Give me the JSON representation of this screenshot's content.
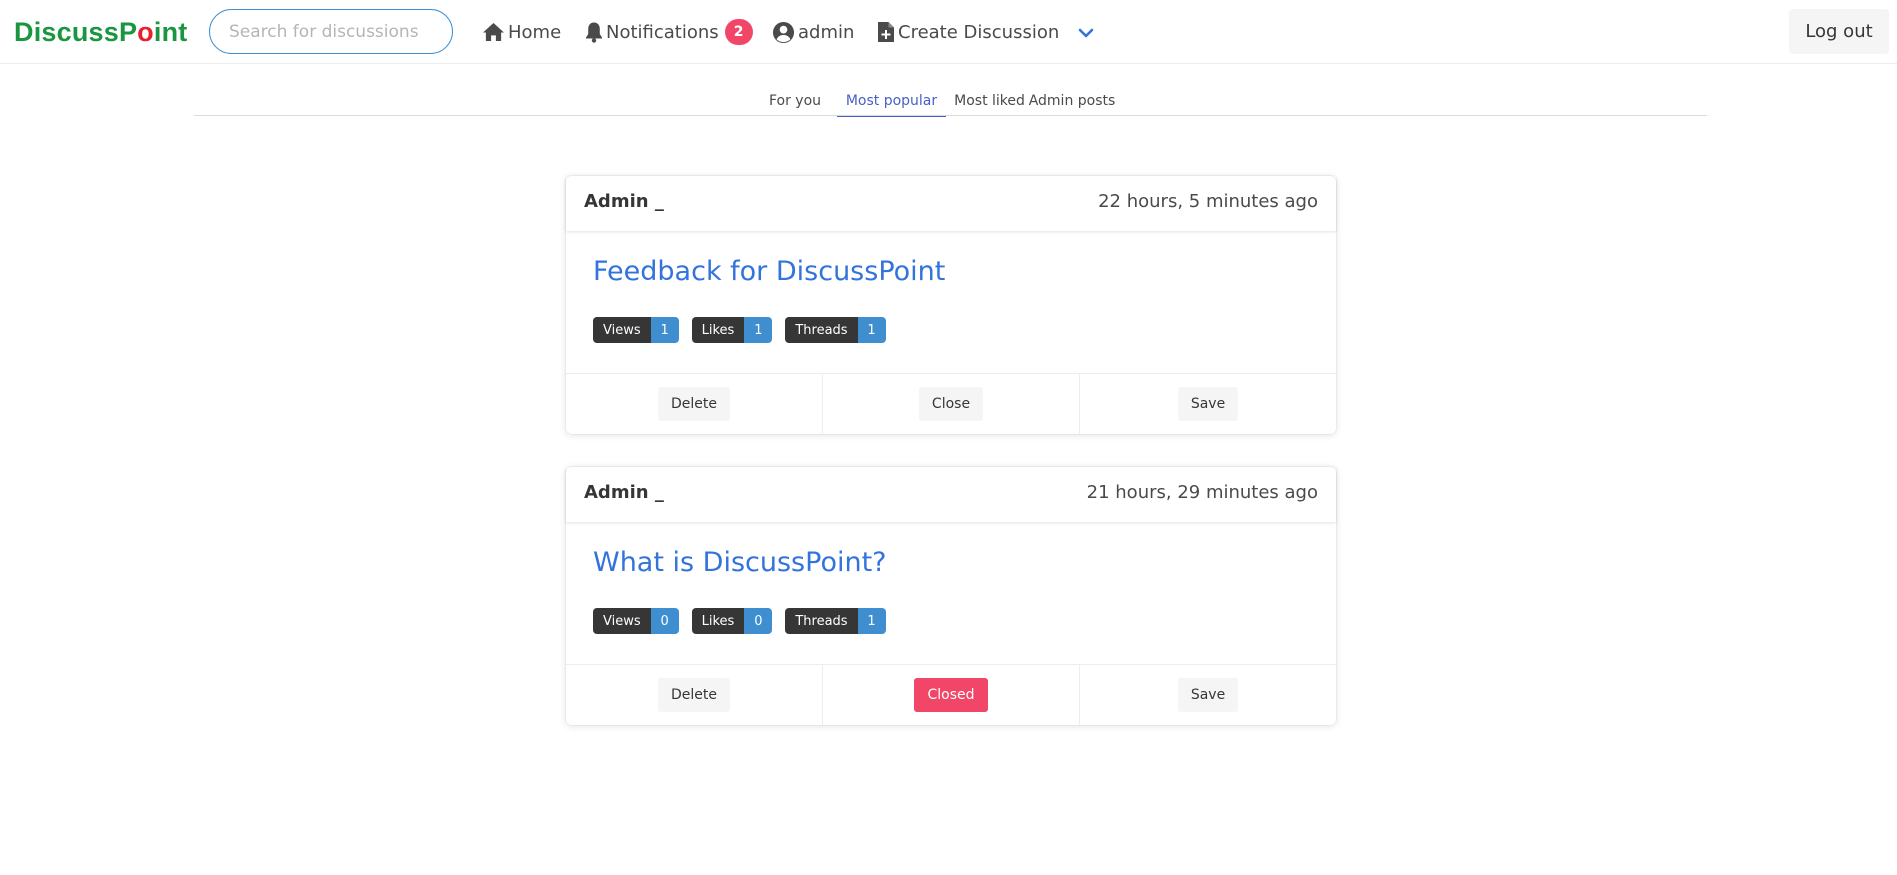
{
  "brand": {
    "part1": "DiscussP",
    "part2": "o",
    "part3": "int"
  },
  "search": {
    "placeholder": "Search for discussions"
  },
  "nav": {
    "home": "Home",
    "notifications": "Notifications",
    "notification_count": "2",
    "user": "admin",
    "create": "Create Discussion",
    "logout": "Log out"
  },
  "tabs": [
    "For you",
    "Most popular",
    "Most liked",
    "Admin posts"
  ],
  "active_tab": "Most popular",
  "posts": [
    {
      "author": "Admin _",
      "time": "22 hours, 5 minutes ago",
      "title": "Feedback for DiscussPoint",
      "stats": [
        {
          "label": "Views",
          "value": "1"
        },
        {
          "label": "Likes",
          "value": "1"
        },
        {
          "label": "Threads",
          "value": "1"
        }
      ],
      "actions": {
        "delete": "Delete",
        "close": "Close",
        "save": "Save"
      }
    },
    {
      "author": "Admin _",
      "time": "21 hours, 29 minutes ago",
      "title": "What is DiscussPoint?",
      "stats": [
        {
          "label": "Views",
          "value": "0"
        },
        {
          "label": "Likes",
          "value": "0"
        },
        {
          "label": "Threads",
          "value": "1"
        }
      ],
      "actions": {
        "delete": "Delete",
        "close": "Closed",
        "save": "Save"
      }
    }
  ],
  "colors": {
    "brand_green": "#1a9641",
    "brand_red": "#e8202e",
    "link": "#3273dc",
    "tag_value": "#3e8ed0",
    "danger": "#f14668",
    "tab_active": "#485fc7"
  },
  "icons": [
    "home-icon",
    "bell-icon",
    "user-circle-icon",
    "file-plus-icon",
    "chevron-down-icon"
  ]
}
